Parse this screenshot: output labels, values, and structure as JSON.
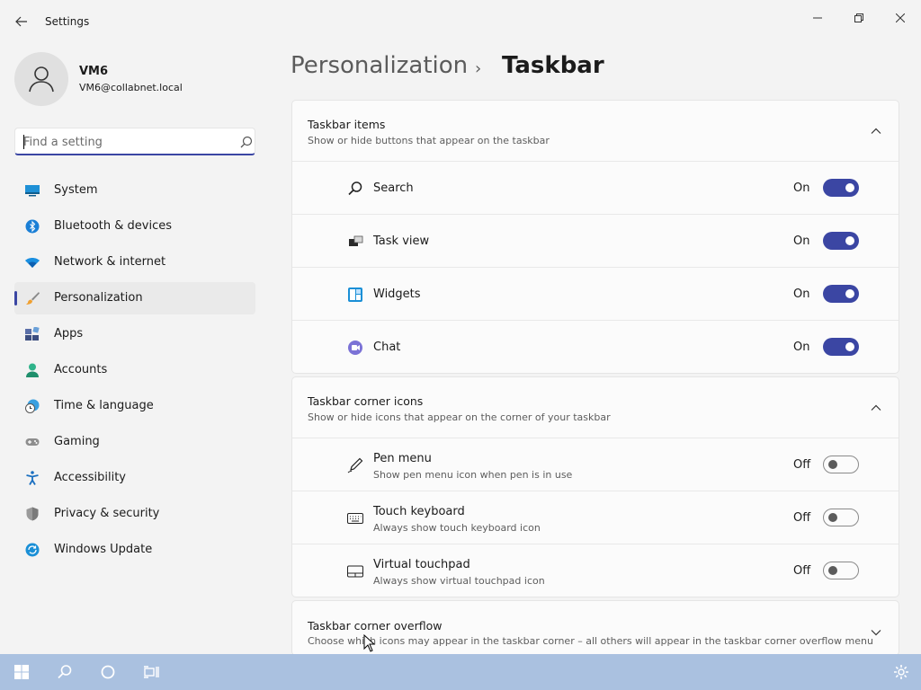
{
  "window": {
    "title": "Settings",
    "controls": {
      "minimize": "minimize-icon",
      "maximize": "restore-icon",
      "close": "close-icon"
    }
  },
  "profile": {
    "name": "VM6",
    "email": "VM6@collabnet.local"
  },
  "search": {
    "placeholder": "Find a setting",
    "value": ""
  },
  "sidebar": {
    "items": [
      {
        "label": "System",
        "icon": "monitor-icon"
      },
      {
        "label": "Bluetooth & devices",
        "icon": "bluetooth-icon"
      },
      {
        "label": "Network & internet",
        "icon": "wifi-icon"
      },
      {
        "label": "Personalization",
        "icon": "brush-icon",
        "active": true
      },
      {
        "label": "Apps",
        "icon": "apps-icon"
      },
      {
        "label": "Accounts",
        "icon": "person-icon"
      },
      {
        "label": "Time & language",
        "icon": "globe-clock-icon"
      },
      {
        "label": "Gaming",
        "icon": "gamepad-icon"
      },
      {
        "label": "Accessibility",
        "icon": "accessibility-icon"
      },
      {
        "label": "Privacy & security",
        "icon": "shield-icon"
      },
      {
        "label": "Windows Update",
        "icon": "update-icon"
      }
    ]
  },
  "breadcrumb": {
    "parent": "Personalization",
    "separator": "›",
    "current": "Taskbar"
  },
  "sections": {
    "taskbar_items": {
      "title": "Taskbar items",
      "subtitle": "Show or hide buttons that appear on the taskbar",
      "expanded": true,
      "rows": [
        {
          "label": "Search",
          "state": "On",
          "on": true,
          "icon": "search-icon"
        },
        {
          "label": "Task view",
          "state": "On",
          "on": true,
          "icon": "task-view-icon"
        },
        {
          "label": "Widgets",
          "state": "On",
          "on": true,
          "icon": "widgets-icon"
        },
        {
          "label": "Chat",
          "state": "On",
          "on": true,
          "icon": "chat-icon"
        }
      ]
    },
    "corner_icons": {
      "title": "Taskbar corner icons",
      "subtitle": "Show or hide icons that appear on the corner of your taskbar",
      "expanded": true,
      "rows": [
        {
          "label": "Pen menu",
          "sub": "Show pen menu icon when pen is in use",
          "state": "Off",
          "on": false,
          "icon": "pen-icon"
        },
        {
          "label": "Touch keyboard",
          "sub": "Always show touch keyboard icon",
          "state": "Off",
          "on": false,
          "icon": "keyboard-icon"
        },
        {
          "label": "Virtual touchpad",
          "sub": "Always show virtual touchpad icon",
          "state": "Off",
          "on": false,
          "icon": "touchpad-icon"
        }
      ]
    },
    "corner_overflow": {
      "title": "Taskbar corner overflow",
      "subtitle": "Choose which icons may appear in the taskbar corner – all others will appear in the taskbar corner overflow menu",
      "expanded": false
    }
  },
  "taskbar": {
    "buttons": [
      "start-icon",
      "search-icon",
      "cortana-icon",
      "task-view-icon",
      "settings-gear-icon"
    ],
    "color": "#aac1e0"
  },
  "colors": {
    "accent": "#3b46a3",
    "background": "#f3f3f3",
    "card": "#fbfbfb"
  }
}
